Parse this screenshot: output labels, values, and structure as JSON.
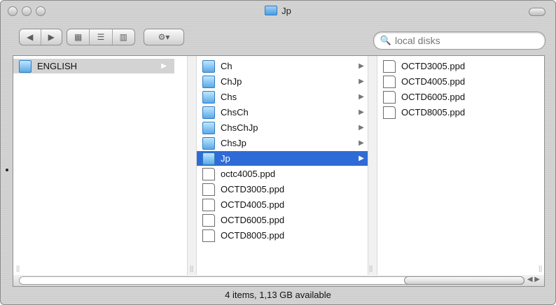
{
  "window": {
    "title": "Jp",
    "status": "4 items, 1,13 GB available"
  },
  "toolbar": {
    "search_placeholder": "local disks",
    "action_label": "⚙▾"
  },
  "columns": [
    {
      "items": [
        {
          "label": "ENGLISH",
          "type": "folder",
          "has_children": true,
          "selected": true
        }
      ]
    },
    {
      "items": [
        {
          "label": "Ch",
          "type": "folder",
          "has_children": true
        },
        {
          "label": "ChJp",
          "type": "folder",
          "has_children": true
        },
        {
          "label": "Chs",
          "type": "folder",
          "has_children": true
        },
        {
          "label": "ChsCh",
          "type": "folder",
          "has_children": true
        },
        {
          "label": "ChsChJp",
          "type": "folder",
          "has_children": true
        },
        {
          "label": "ChsJp",
          "type": "folder",
          "has_children": true
        },
        {
          "label": "Jp",
          "type": "folder",
          "has_children": true,
          "selected": true
        },
        {
          "label": "octc4005.ppd",
          "type": "file"
        },
        {
          "label": "OCTD3005.ppd",
          "type": "file"
        },
        {
          "label": "OCTD4005.ppd",
          "type": "file"
        },
        {
          "label": "OCTD6005.ppd",
          "type": "file"
        },
        {
          "label": "OCTD8005.ppd",
          "type": "file"
        }
      ]
    },
    {
      "items": [
        {
          "label": "OCTD3005.ppd",
          "type": "file"
        },
        {
          "label": "OCTD4005.ppd",
          "type": "file"
        },
        {
          "label": "OCTD6005.ppd",
          "type": "file"
        },
        {
          "label": "OCTD8005.ppd",
          "type": "file"
        }
      ]
    }
  ]
}
